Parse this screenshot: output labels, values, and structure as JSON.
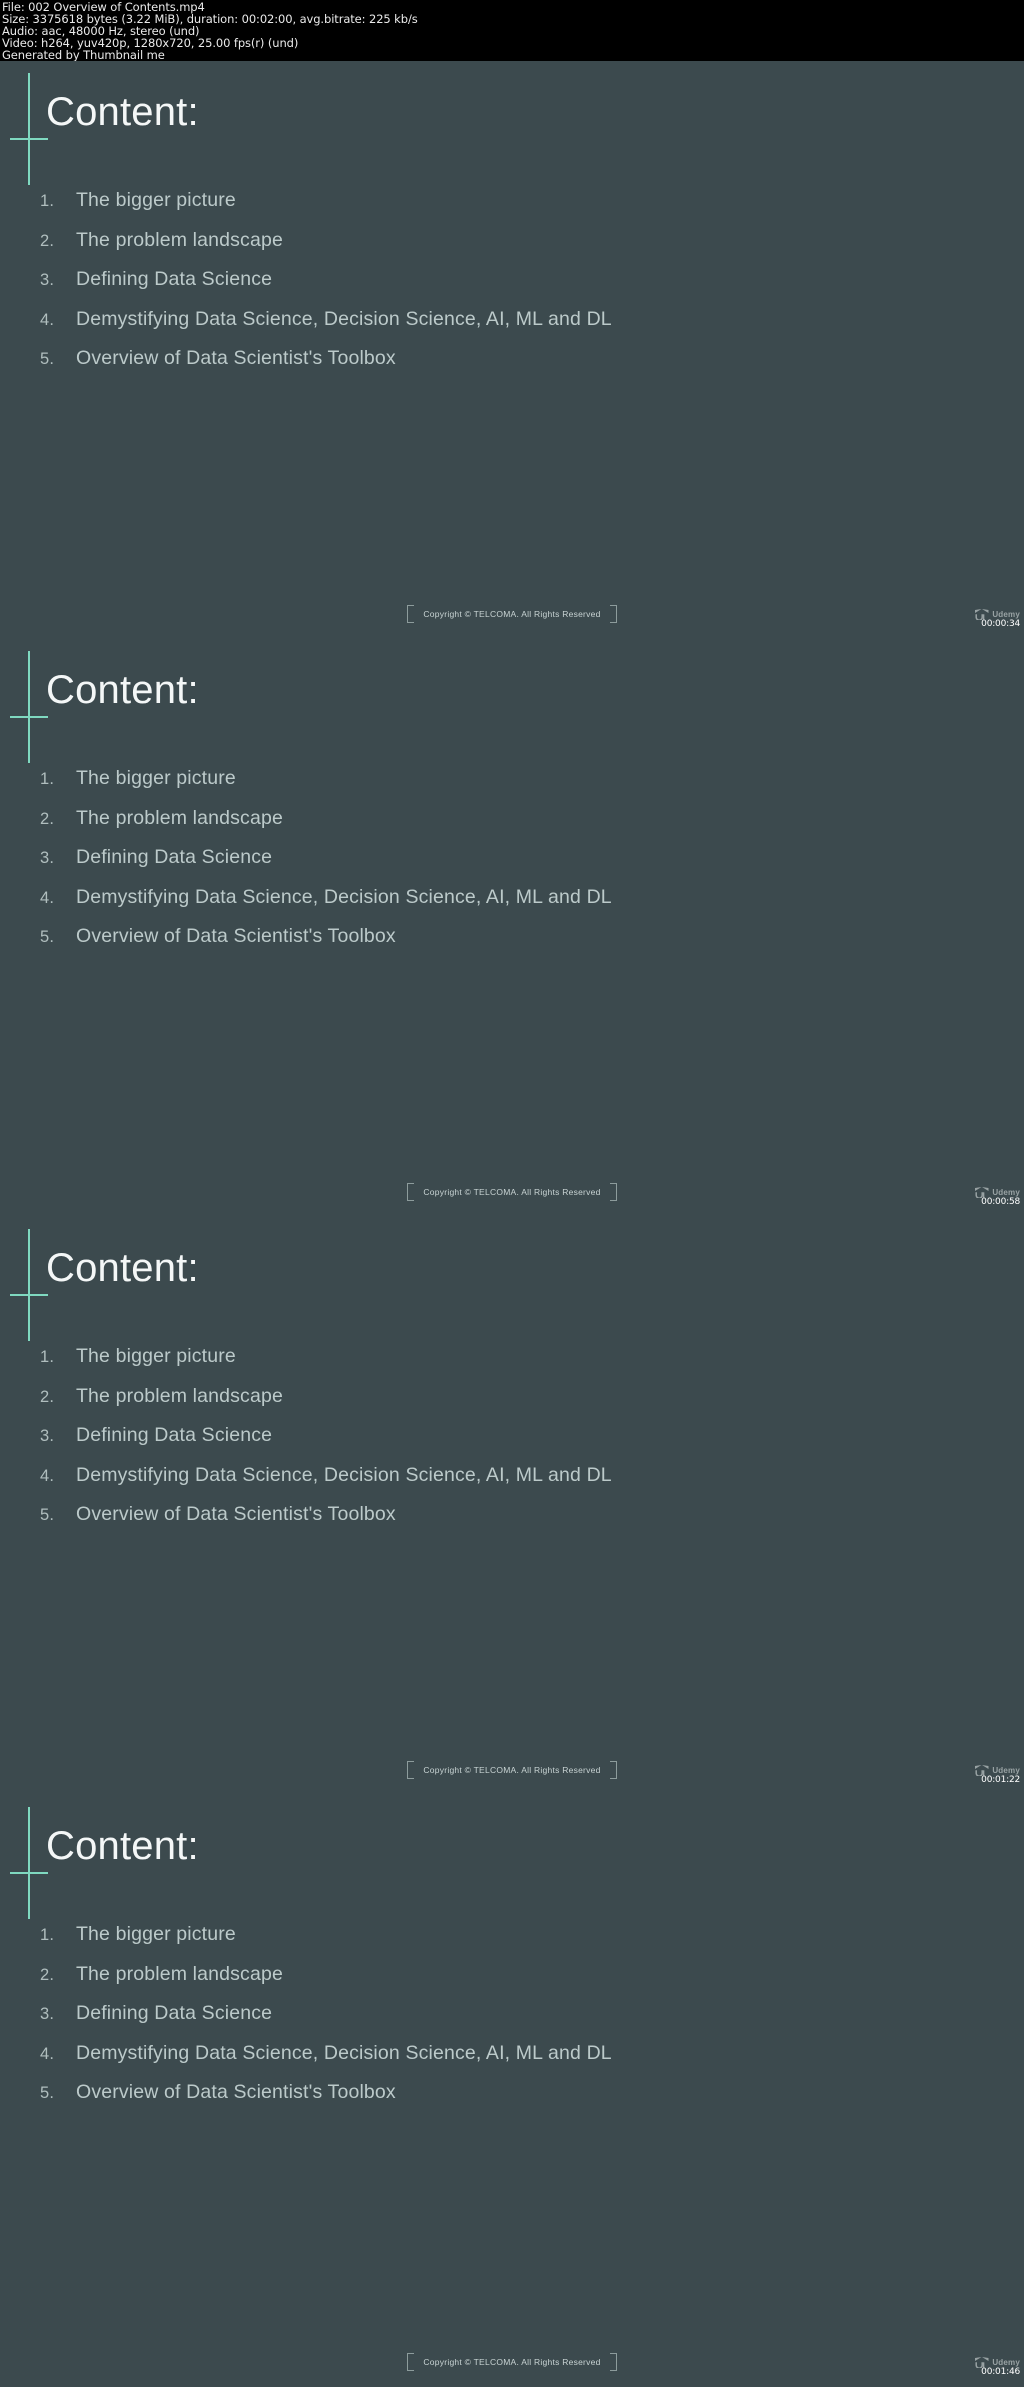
{
  "meta": {
    "lines": [
      "File: 002 Overview of Contents.mp4",
      "Size: 3375618 bytes (3.22 MiB), duration: 00:02:00, avg.bitrate: 225 kb/s",
      "Audio: aac, 48000 Hz, stereo (und)",
      "Video: h264, yuv420p, 1280x720, 25.00 fps(r) (und)",
      "Generated by Thumbnail me"
    ],
    "file_name": "002 Overview of Contents.mp4",
    "size_bytes": "3375618 bytes",
    "size_human": "3.22 MiB",
    "duration": "00:02:00",
    "avg_bitrate": "225 kb/s",
    "audio_codec": "aac",
    "audio_rate": "48000 Hz",
    "audio_channels": "stereo (und)",
    "video_codec": "h264",
    "pixel_format": "yuv420p",
    "resolution": "1280x720",
    "fps": "25.00 fps(r) (und)",
    "generator": "Generated by Thumbnail me"
  },
  "slide": {
    "title": "Content:",
    "items": [
      {
        "num": "1.",
        "text": "The bigger picture"
      },
      {
        "num": "2.",
        "text": "The problem landscape"
      },
      {
        "num": "3.",
        "text": "Defining Data Science"
      },
      {
        "num": "4.",
        "text": "Demystifying Data Science, Decision Science, AI, ML and DL"
      },
      {
        "num": "5.",
        "text": "Overview of Data Scientist's Toolbox"
      }
    ],
    "copyright": "Copyright © TELCOMA.  All Rights Reserved",
    "watermark_brand": "Udemy"
  },
  "colors": {
    "slide_background": "#3c4a4e",
    "accent": "#7fd9c0",
    "title_text": "#f4f7f7",
    "body_text": "#bccaca",
    "header_background": "#000000",
    "header_text": "#eaeaea"
  },
  "frames": [
    {
      "timestamp": "00:00:34"
    },
    {
      "timestamp": "00:00:58"
    },
    {
      "timestamp": "00:01:22"
    },
    {
      "timestamp": "00:01:46"
    }
  ]
}
